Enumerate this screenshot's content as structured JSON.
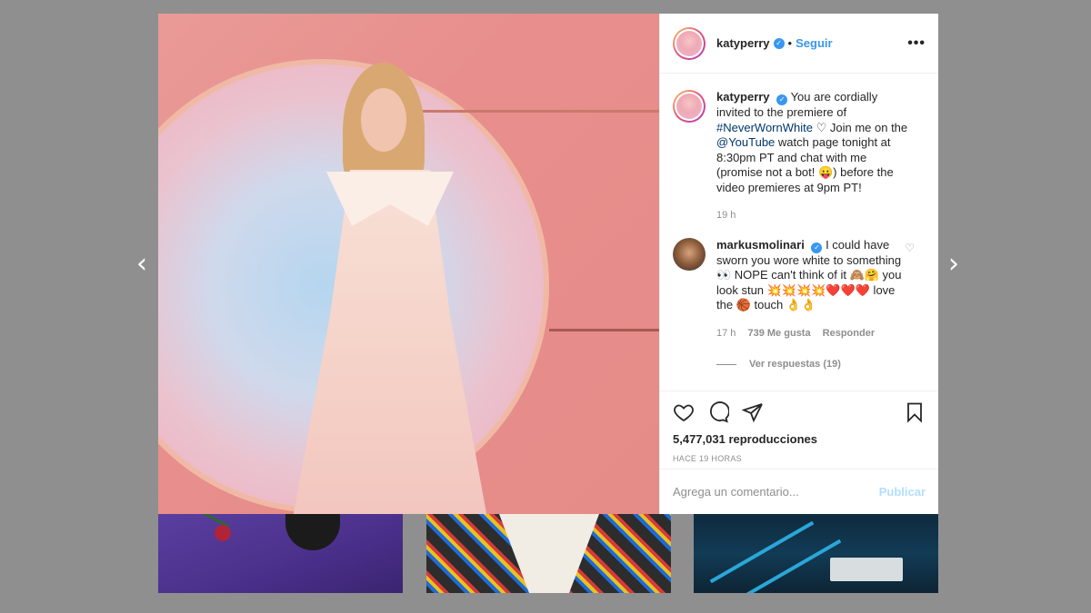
{
  "nav": {
    "prev_icon": "chevron-left-icon",
    "next_icon": "chevron-right-icon",
    "prev": "‹",
    "next": "›"
  },
  "post": {
    "author": "katyperry",
    "follow_label": "Seguir",
    "separator": "•",
    "more": "•••",
    "caption": {
      "username": "katyperry",
      "text_before_tag": "You are cordially invited to the premiere of",
      "hashtag": "#NeverWornWhite",
      "text_after_tag": "♡ Join me on the",
      "mention": "@YouTube",
      "text_end": "watch page tonight at 8:30pm PT and chat with me (promise not a bot! 😛) before the video premieres at 9pm PT!",
      "time": "19 h"
    },
    "comment": {
      "username": "markusmolinari",
      "text": "I could have sworn you wore white to something 👀 NOPE can't think of it 🙈🤗 you look stun 💥💥💥💥❤️❤️❤️ love the 🏀 touch 👌👌",
      "time": "17 h",
      "likes": "739 Me gusta",
      "reply_label": "Responder",
      "view_replies": "Ver respuestas (19)"
    },
    "views": "5,477,031 reproducciones",
    "posted_ago": "HACE 19 HORAS",
    "comment_placeholder": "Agrega un comentario...",
    "publish_label": "Publicar"
  },
  "colors": {
    "accent": "#3897f0",
    "publish_disabled": "#b2dffc",
    "muted": "#8e8e8e",
    "backdrop": "#8f8f8f"
  }
}
